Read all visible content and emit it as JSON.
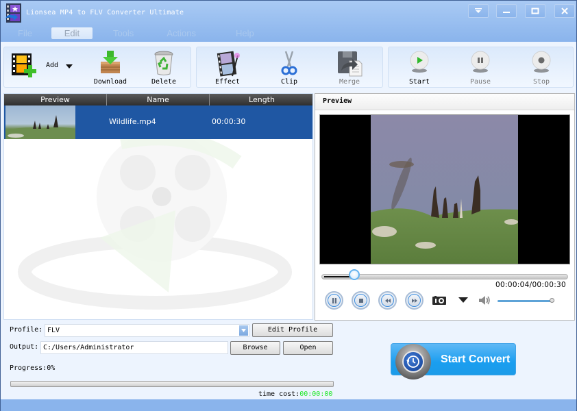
{
  "window": {
    "title": "Lionsea MP4 to FLV Converter Ultimate",
    "controls": [
      "dropdown-menu",
      "minimize",
      "maximize",
      "close"
    ]
  },
  "menu": {
    "items": [
      "File",
      "Edit",
      "Tools",
      "Actions",
      "Help"
    ],
    "active": "Edit"
  },
  "toolbar": {
    "add_label": "Add",
    "download_label": "Download",
    "delete_label": "Delete",
    "effect_label": "Effect",
    "clip_label": "Clip",
    "merge_label": "Merge",
    "start_label": "Start",
    "pause_label": "Pause",
    "stop_label": "Stop"
  },
  "file_list": {
    "columns": [
      "Preview",
      "Name",
      "Length"
    ],
    "rows": [
      {
        "name": "Wildlife.mp4",
        "length": "00:00:30",
        "selected": true
      }
    ]
  },
  "preview": {
    "title": "Preview",
    "time_readout": "00:00:04/00:00:30",
    "position_fraction": 0.1333,
    "volume_fraction": 1.0
  },
  "output_settings": {
    "profile_label": "Profile:",
    "profile_value": "FLV",
    "edit_profile_label": "Edit Profile",
    "output_label": "Output:",
    "output_value": "C:/Users/Administrator",
    "browse_label": "Browse",
    "open_label": "Open",
    "progress_label": "Progress:",
    "progress_value": "0%",
    "progress_fraction": 0,
    "time_cost_label": "time cost:",
    "time_cost_value": "00:00:00"
  },
  "start_convert_label": "Start Convert",
  "colors": {
    "titlebar": "#8ab4ec",
    "selected_row": "#1f57a3",
    "start_convert": "#1a9ef0",
    "time_cost": "#22e82a"
  }
}
